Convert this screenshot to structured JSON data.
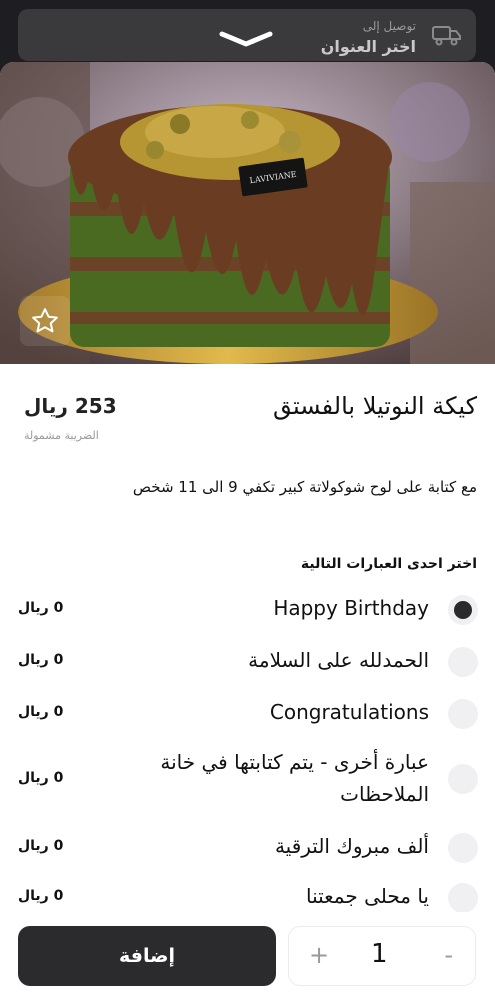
{
  "delivery": {
    "label": "توصيل إلى",
    "value": "اختر العنوان"
  },
  "product": {
    "title": "كيكة النوتيلا بالفستق",
    "price": "253 ريال",
    "tax_note": "الضريبة مشمولة",
    "description": "مع كتابة على لوح شوكولاتة كبير تكفي 9 الى 11 شخص",
    "plaque_text": "LAVIVIANE"
  },
  "options_section": {
    "title": "اختر احدى العبارات التالية",
    "items": [
      {
        "label": "Happy Birthday",
        "price": "0 ريال",
        "selected": true
      },
      {
        "label": "الحمدلله على السلامة",
        "price": "0 ريال",
        "selected": false
      },
      {
        "label": "Congratulations",
        "price": "0 ريال",
        "selected": false
      },
      {
        "label": "عبارة أخرى -  يتم كتابتها في خانة الملاحظات",
        "price": "0 ريال",
        "selected": false
      },
      {
        "label": "ألف مبروك الترقية",
        "price": "0 ريال",
        "selected": false
      },
      {
        "label": "يا محلى جمعتنا",
        "price": "0 ريال",
        "selected": false
      }
    ]
  },
  "cart": {
    "add_label": "إضافة",
    "quantity": "1",
    "plus": "+",
    "minus": "-"
  },
  "colors": {
    "dark": "#2b2b2e",
    "radio_bg": "#f0f0f2",
    "muted": "#9a9a9a"
  }
}
